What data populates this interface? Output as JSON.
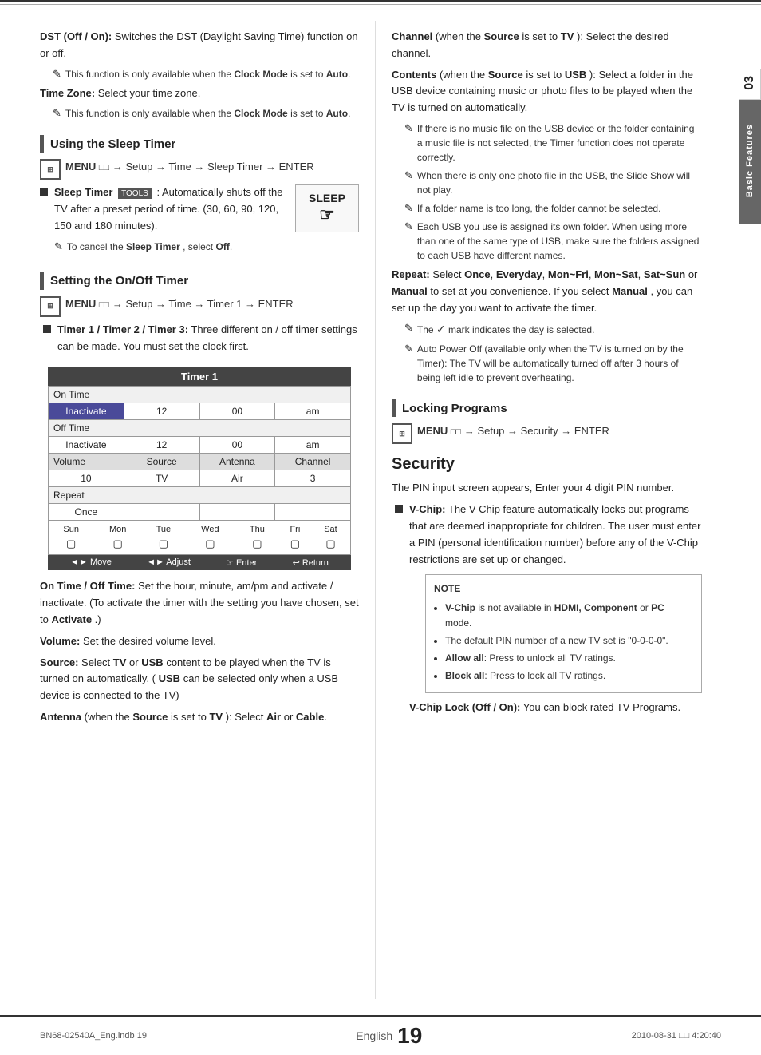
{
  "page": {
    "number": "19",
    "language": "English",
    "chapter": "03",
    "chapter_label": "Basic Features",
    "bottom_left": "BN68-02540A_Eng.indb   19",
    "bottom_right": "2010-08-31   □□ 4:20:40"
  },
  "left_column": {
    "dst_section": {
      "dst_heading": "DST (Off / On):",
      "dst_text": "Switches the DST (Daylight Saving Time) function on or off.",
      "dst_note1": "This function is only available when the",
      "dst_note1_bold": "Clock Mode",
      "dst_note1_end": "is set to",
      "dst_note1_auto": "Auto",
      "tz_heading": "Time Zone:",
      "tz_text": "Select your time zone.",
      "tz_note1": "This function is only available when the",
      "tz_note1_bold": "Clock Mode",
      "tz_note1_end": "is set to",
      "tz_note1_auto": "Auto"
    },
    "sleep_timer_section": {
      "heading": "Using the Sleep Timer",
      "menu_instruction": "MENU",
      "menu_arrow": "→ Setup → Time → Sleep Timer → ENTER",
      "bullet_label": "Sleep Timer",
      "tools_label": "TOOLS",
      "bullet_text": ": Automatically shuts off the TV after a preset period of time. (30, 60, 90, 120, 150 and 180 minutes).",
      "note_text": "To cancel the",
      "note_bold": "Sleep Timer",
      "note_end": ", select",
      "note_off": "Off",
      "sleep_display": "SLEEP"
    },
    "on_off_timer_section": {
      "heading": "Setting the On/Off Timer",
      "menu_instruction": "MENU",
      "menu_arrow": "→ Setup → Time → Timer 1 → ENTER",
      "bullet_text": "Timer 1 / Timer 2 / Timer 3:",
      "bullet_text2": "Three different on / off timer settings can be made. You must set the clock first.",
      "timer_title": "Timer 1",
      "timer_rows": [
        {
          "label": "On Time",
          "col1": "",
          "col2": "",
          "col3": ""
        },
        {
          "label": "",
          "col1_highlight": "Inactivate",
          "col2": "12",
          "col3": "00",
          "col4": "am"
        },
        {
          "label": "Off Time",
          "col1": "",
          "col2": "",
          "col3": ""
        },
        {
          "label": "",
          "col1": "Inactivate",
          "col2": "12",
          "col3": "00",
          "col4": "am"
        },
        {
          "label": "Volume",
          "col1": "Source",
          "col2": "Antenna",
          "col3": "Channel"
        },
        {
          "label": "",
          "col1": "10",
          "col2": "TV",
          "col3": "Air",
          "col4": "3"
        },
        {
          "label": "Repeat",
          "col1": "",
          "col2": "",
          "col3": ""
        },
        {
          "label": "",
          "col1": "Once",
          "col2": "",
          "col3": "",
          "col4": ""
        }
      ],
      "days": [
        "Sun",
        "Mon",
        "Tue",
        "Wed",
        "Thu",
        "Fri",
        "Sat"
      ],
      "nav_move": "◄► Move",
      "nav_adjust": "◄► Adjust",
      "nav_enter": "☞ Enter",
      "nav_return": "↩ Return",
      "on_off_time_text": "On Time / Off Time:",
      "on_off_time_desc": "Set the hour, minute, am/pm and activate / inactivate. (To activate the timer with the setting you have chosen, set to",
      "on_off_time_bold": "Activate",
      "on_off_time_end": ".)",
      "volume_text": "Volume:",
      "volume_desc": "Set the desired volume level.",
      "source_text": "Source:",
      "source_desc": "Select",
      "source_tv": "TV",
      "source_or": "or",
      "source_usb": "USB",
      "source_desc2": "content to be played when the TV is turned on automatically. (",
      "source_usb2": "USB",
      "source_desc3": "can be selected only when a USB device is connected to the TV)",
      "antenna_text": "Antenna",
      "antenna_desc": "(when the",
      "antenna_source": "Source",
      "antenna_desc2": "is set to",
      "antenna_tv": "TV",
      "antenna_desc3": "): Select",
      "antenna_air": "Air",
      "antenna_or": "or",
      "antenna_cable": "Cable"
    }
  },
  "right_column": {
    "channel_section": {
      "channel_text": "Channel",
      "channel_paren": "(when the",
      "channel_source": "Source",
      "channel_is": "is set to",
      "channel_tv": "TV",
      "channel_end": "): Select the desired channel.",
      "contents_text": "Contents",
      "contents_paren": "(when the",
      "contents_source": "Source",
      "contents_is": "is set to",
      "contents_usb": "USB",
      "contents_end": "): Select a folder in the USB device containing music or photo files to be played when the TV is turned on automatically.",
      "note1": "If there is no music file on the USB device or the folder containing a music file is not selected, the Timer function does not operate correctly.",
      "note2": "When there is only one photo file in the USB, the Slide Show will not play.",
      "note3": "If a folder name is too long, the folder cannot be selected.",
      "note4": "Each USB you use is assigned its own folder. When using more than one of the same type of USB, make sure the folders assigned to each USB have different names.",
      "repeat_text": "Repeat:",
      "repeat_desc": "Select",
      "repeat_once": "Once",
      "repeat_comma1": ",",
      "repeat_everyday": "Everyday",
      "repeat_comma2": ",",
      "repeat_mon_fri": "Mon~Fri",
      "repeat_comma3": ",",
      "repeat_mon_sat": "Mon~Sat",
      "repeat_comma4": ",",
      "repeat_sat_sun": "Sat~Sun",
      "repeat_or": "or",
      "repeat_manual": "Manual",
      "repeat_desc2": "to set at you convenience. If you select",
      "repeat_manual2": "Manual",
      "repeat_desc3": ", you can set up the day you want to activate the timer.",
      "repeat_note": "The ✓ mark indicates the day is selected.",
      "auto_power_text": "Auto Power Off (available only when the TV is turned on by the Timer): The TV will be automatically turned off after 3 hours of being left idle to prevent overheating."
    },
    "locking_section": {
      "heading": "Locking Programs",
      "menu_instruction": "MENU",
      "menu_arrow": "→ Setup → Security → ENTER"
    },
    "security_section": {
      "title": "Security",
      "intro": "The PIN input screen appears, Enter your 4 digit PIN number.",
      "v_chip_text": "V-Chip:",
      "v_chip_desc": "The V-Chip feature automatically locks out programs that are deemed inappropriate for children. The user must enter a PIN (personal identification number) before any of the V-Chip restrictions are set up or changed.",
      "note_label": "NOTE",
      "note_items": [
        {
          "bold": "V-Chip",
          "text": " is not available in ",
          "bold2": "HDMI, Component",
          "text2": " or ",
          "bold3": "PC",
          "text3": " mode."
        },
        {
          "text": "The default PIN number of a new TV set is \"0-0-0-0\"."
        },
        {
          "bold": "Allow all",
          "text": ": Press to unlock all TV ratings."
        },
        {
          "bold": "Block all",
          "text": ": Press to lock all TV ratings."
        }
      ],
      "v_chip_lock_bold": "V-Chip Lock (Off / On):",
      "v_chip_lock_desc": "You can block rated TV Programs."
    }
  }
}
